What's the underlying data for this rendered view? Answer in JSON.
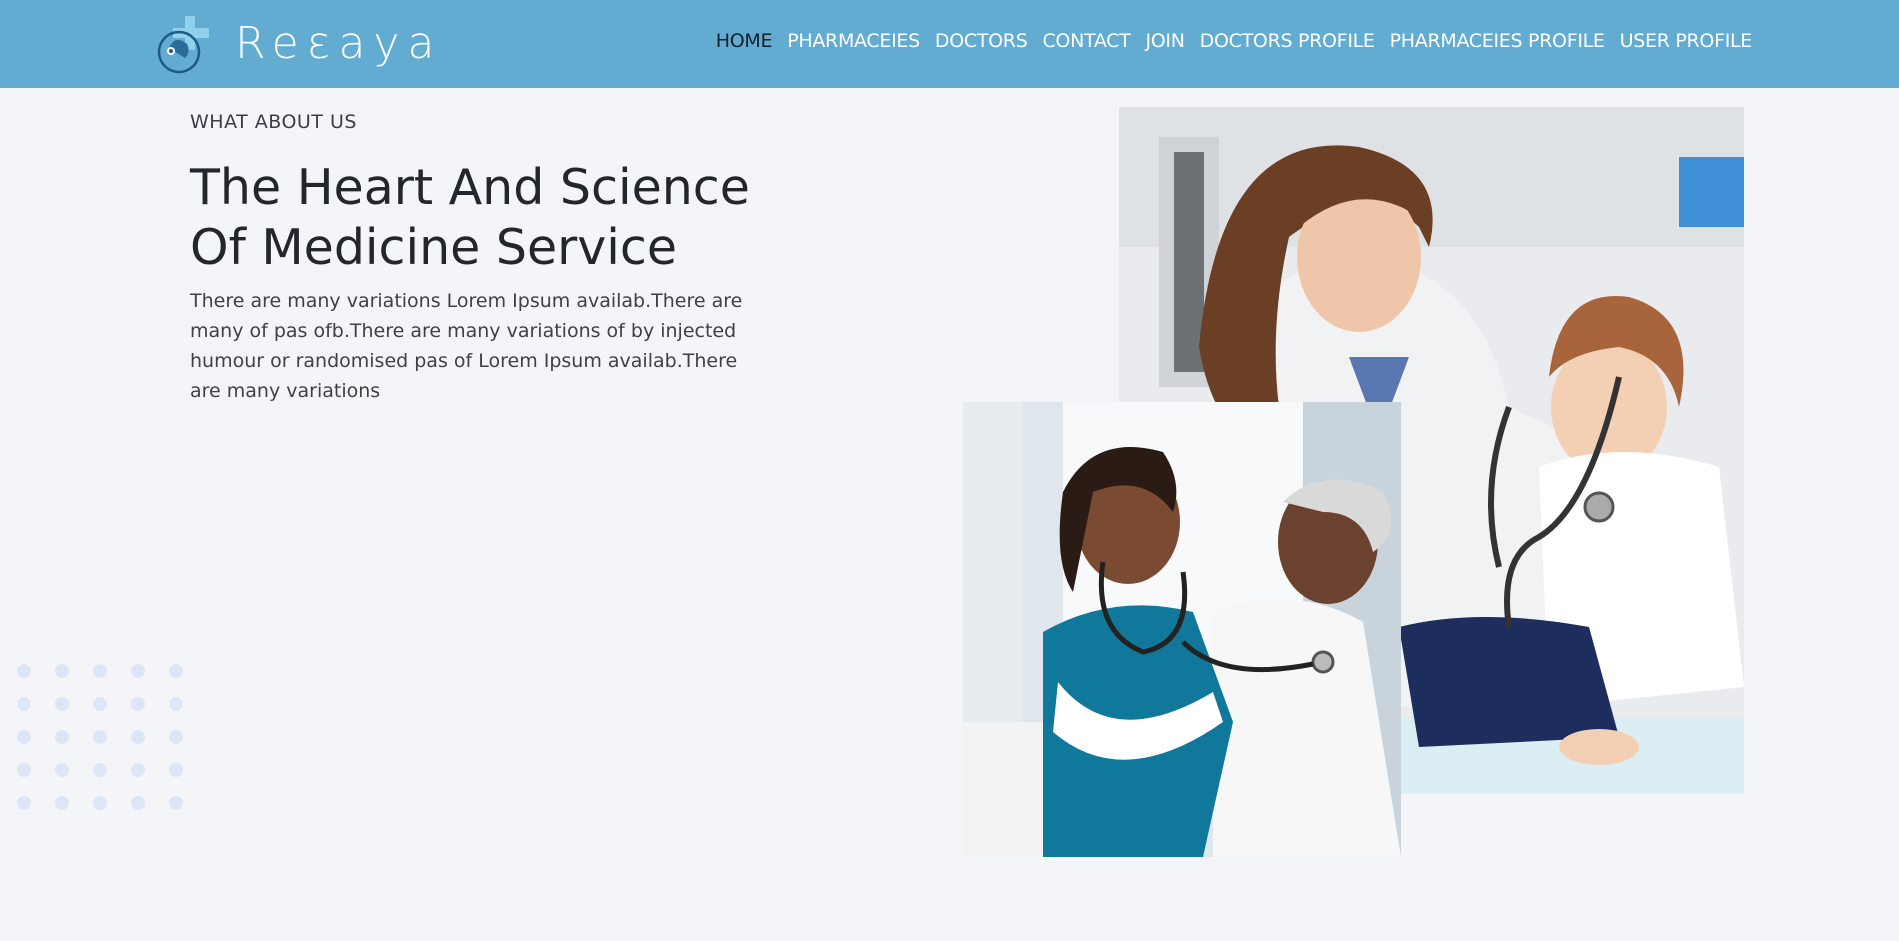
{
  "brand": {
    "name": "Reεaya",
    "icon": "medical-cross-stethoscope-icon"
  },
  "nav": {
    "items": [
      {
        "label": "HOME",
        "active": true
      },
      {
        "label": "PHARMACEIES",
        "active": false
      },
      {
        "label": "DOCTORS",
        "active": false
      },
      {
        "label": "CONTACT",
        "active": false
      },
      {
        "label": "JOIN",
        "active": false
      },
      {
        "label": "DOCTORS PROFILE",
        "active": false
      },
      {
        "label": "PHARMACEIES PROFILE",
        "active": false
      },
      {
        "label": "USER PROFILE",
        "active": false
      }
    ]
  },
  "hero": {
    "eyebrow": "WHAT ABOUT US",
    "title": "The Heart And Science Of Medicine Service",
    "text": "There are many variations Lorem Ipsum availab.There are many of pas ofb.There are many variations of by injected humour or randomised pas of Lorem Ipsum availab.There are many variations"
  },
  "images": {
    "back": "doctor-examining-child-photo",
    "front": "nurse-examining-elderly-woman-photo"
  },
  "colors": {
    "navbar": "#62acd1",
    "background": "#f4f5f9",
    "active_nav": "#14202b",
    "dots": "#dde6f6"
  }
}
